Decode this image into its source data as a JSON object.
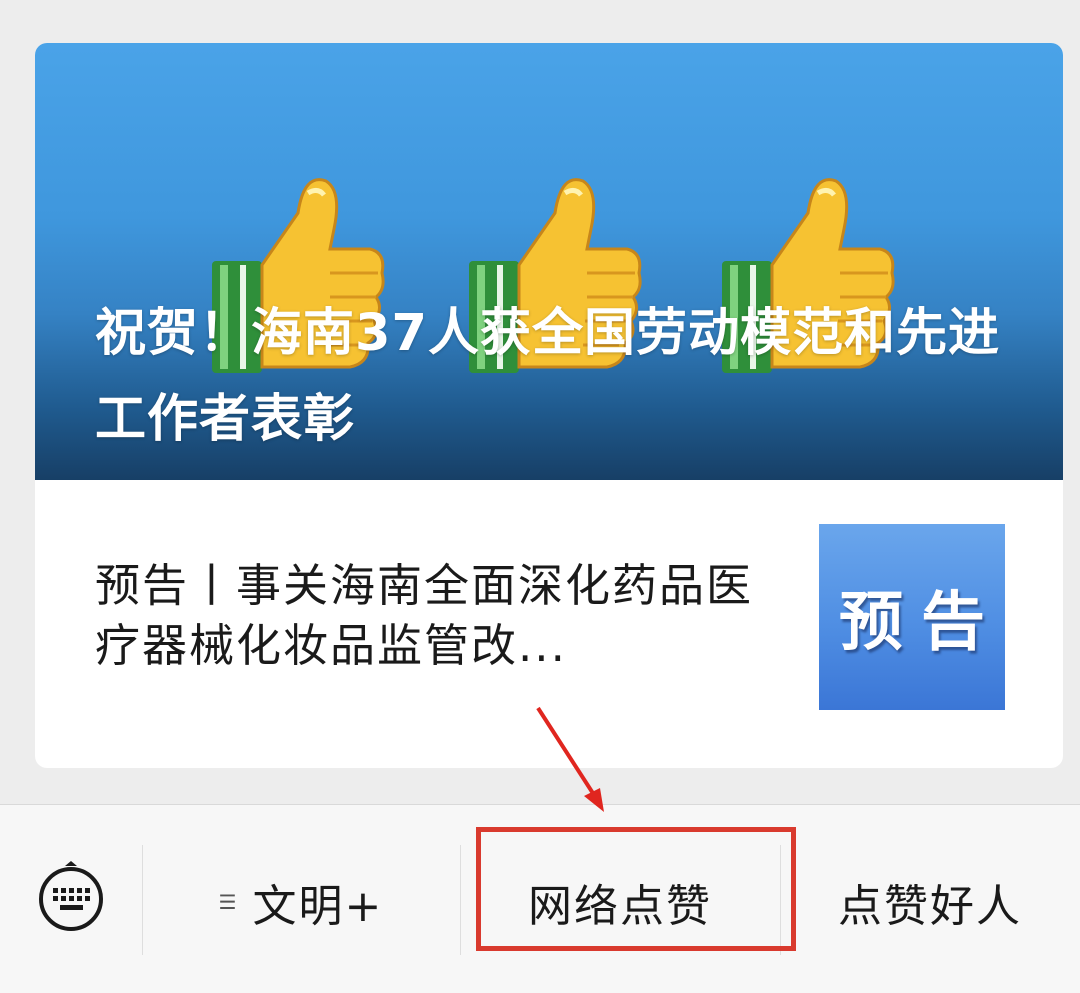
{
  "banner": {
    "title": "祝贺！海南37人获全国劳动模范和先进工作者表彰",
    "image_icons": [
      "thumbs-up-icon",
      "thumbs-up-icon",
      "thumbs-up-icon"
    ]
  },
  "article": {
    "title": "预告丨事关海南全面深化药品医疗器械化妆品监管改...",
    "thumbnail_text": "预告"
  },
  "menu": {
    "keyboard_icon": "keyboard-icon",
    "items": [
      {
        "label": "文明+",
        "has_submenu": true
      },
      {
        "label": "网络点赞",
        "highlighted": true
      },
      {
        "label": "点赞好人"
      }
    ]
  },
  "colors": {
    "banner_blue": "#4aa3e8",
    "highlight_red": "#d93a2e",
    "menu_bg": "#f7f7f7",
    "page_bg": "#ededed"
  }
}
